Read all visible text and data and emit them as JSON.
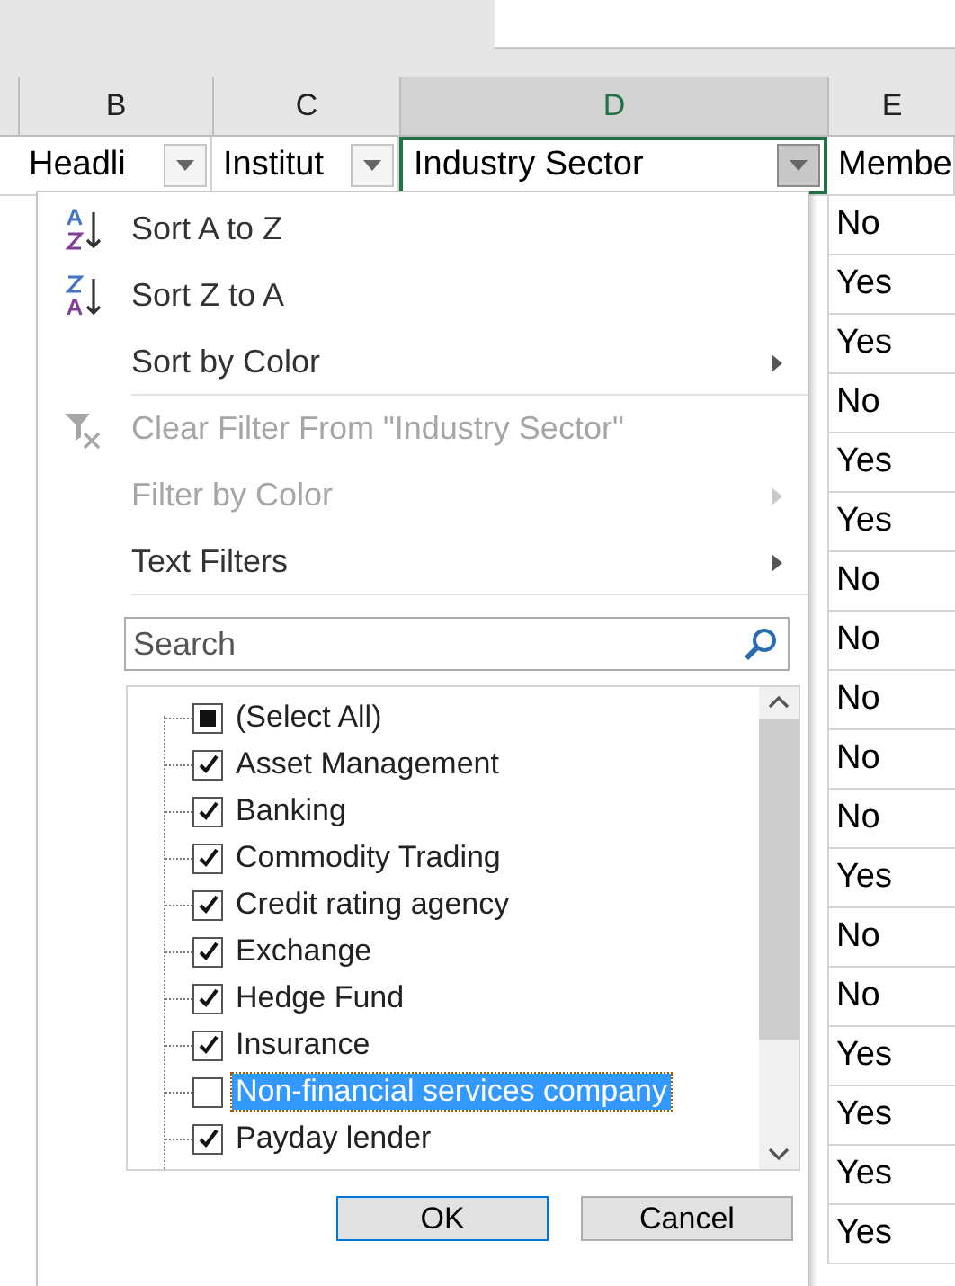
{
  "columns": [
    {
      "letter": "B",
      "selected": false
    },
    {
      "letter": "C",
      "selected": false
    },
    {
      "letter": "D",
      "selected": true
    },
    {
      "letter": "E",
      "selected": false
    }
  ],
  "header_cells": [
    {
      "text": "Headli",
      "filter_open": false
    },
    {
      "text": "Institut",
      "filter_open": false
    },
    {
      "text": "Industry Sector",
      "filter_open": true
    },
    {
      "text": "Membe",
      "filter_open": false
    }
  ],
  "column_e_values": [
    "No",
    "Yes",
    "Yes",
    "No",
    "Yes",
    "Yes",
    "No",
    "No",
    "No",
    "No",
    "No",
    "Yes",
    "No",
    "No",
    "Yes",
    "Yes",
    "Yes",
    "Yes"
  ],
  "filter_menu": {
    "items": [
      {
        "kind": "sort-asc",
        "label": "Sort A to Z",
        "disabled": false,
        "submenu": false,
        "separator_after": false
      },
      {
        "kind": "sort-desc",
        "label": "Sort Z to A",
        "disabled": false,
        "submenu": false,
        "separator_after": false
      },
      {
        "kind": "plain",
        "label": "Sort by Color",
        "disabled": false,
        "submenu": true,
        "separator_after": true
      },
      {
        "kind": "clear-filter",
        "label": "Clear Filter From \"Industry Sector\"",
        "disabled": true,
        "submenu": false,
        "separator_after": false
      },
      {
        "kind": "plain",
        "label": "Filter by Color",
        "disabled": true,
        "submenu": true,
        "separator_after": false
      },
      {
        "kind": "plain",
        "label": "Text Filters",
        "disabled": false,
        "submenu": true,
        "separator_after": true
      }
    ],
    "search": {
      "placeholder": "Search"
    },
    "values": [
      {
        "label": "(Select All)",
        "checked": false,
        "partial": true,
        "selected": false
      },
      {
        "label": "Asset Management",
        "checked": true,
        "partial": false,
        "selected": false
      },
      {
        "label": "Banking",
        "checked": true,
        "partial": false,
        "selected": false
      },
      {
        "label": "Commodity Trading",
        "checked": true,
        "partial": false,
        "selected": false
      },
      {
        "label": "Credit rating agency",
        "checked": true,
        "partial": false,
        "selected": false
      },
      {
        "label": "Exchange",
        "checked": true,
        "partial": false,
        "selected": false
      },
      {
        "label": "Hedge Fund",
        "checked": true,
        "partial": false,
        "selected": false
      },
      {
        "label": "Insurance",
        "checked": true,
        "partial": false,
        "selected": false
      },
      {
        "label": "Non-financial services company",
        "checked": false,
        "partial": false,
        "selected": true
      },
      {
        "label": "Payday lender",
        "checked": true,
        "partial": false,
        "selected": false
      }
    ],
    "buttons": [
      "OK",
      "Cancel"
    ]
  }
}
